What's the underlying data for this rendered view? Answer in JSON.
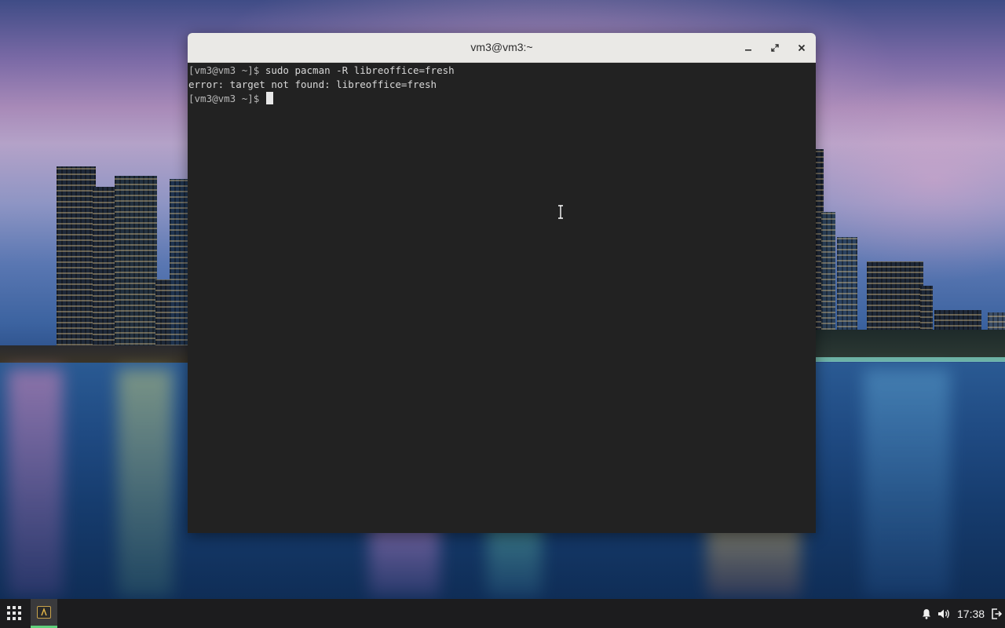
{
  "window": {
    "title": "vm3@vm3:~",
    "controls": [
      "minimize-icon",
      "maximize-icon",
      "close-icon"
    ]
  },
  "terminal": {
    "lines": [
      {
        "prompt": "[vm3@vm3 ~]$ ",
        "text": "sudo pacman -R libreoffice=fresh"
      },
      {
        "prompt": "",
        "text": "error: target not found: libreoffice=fresh"
      },
      {
        "prompt": "[vm3@vm3 ~]$ ",
        "text": ""
      }
    ]
  },
  "taskbar": {
    "app_menu_icon": "app-grid-icon",
    "running_app_icon": "terminal-icon",
    "tray": {
      "notification_icon": "bell-icon",
      "volume_icon": "speaker-icon",
      "clock": "17:38",
      "logout_icon": "logout-icon"
    }
  },
  "colors": {
    "terminal_bg": "#222222",
    "titlebar_bg": "#eae9e6",
    "taskbar_bg": "#1c1c1e",
    "active_task_accent": "#5fd07c"
  }
}
